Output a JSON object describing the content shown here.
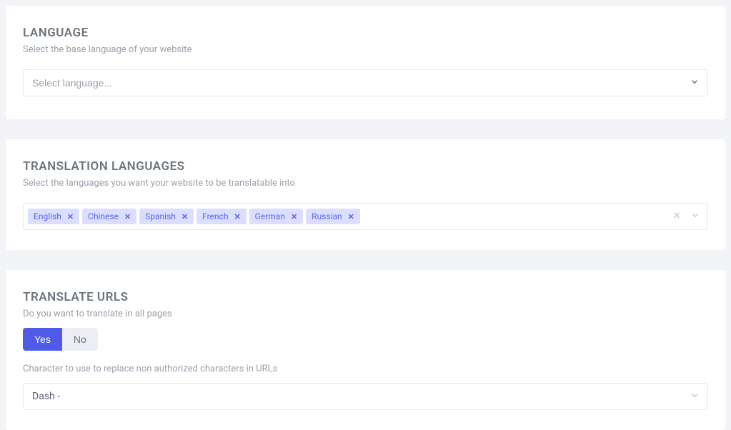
{
  "language": {
    "title": "LANGUAGE",
    "subtitle": "Select the base language of your website",
    "placeholder": "Select language..."
  },
  "translationLanguages": {
    "title": "TRANSLATION LANGUAGES",
    "subtitle": "Select the languages you want your website to be translatable into",
    "tags": [
      "English",
      "Chinese",
      "Spanish",
      "French",
      "German",
      "Russian"
    ]
  },
  "translateUrls": {
    "title": "TRANSLATE URLS",
    "subtitle": "Do you want to translate in all pages",
    "yes": "Yes",
    "no": "No",
    "charLabel": "Character to use to replace non authorized characters in URLs",
    "charValue": "Dash -"
  }
}
